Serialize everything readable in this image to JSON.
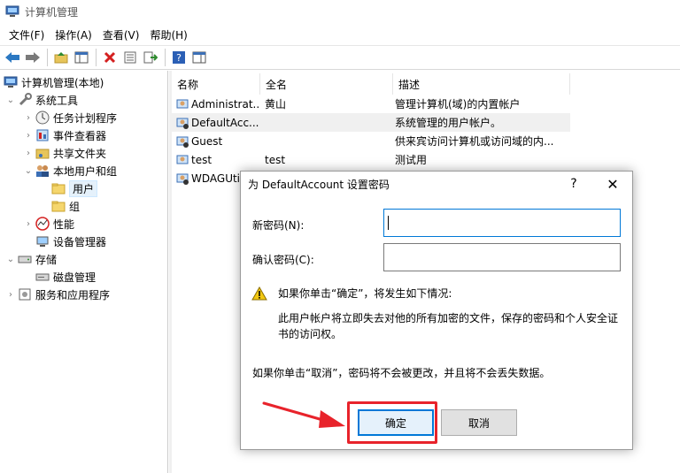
{
  "window": {
    "title": "计算机管理"
  },
  "menu": [
    "文件(F)",
    "操作(A)",
    "查看(V)",
    "帮助(H)"
  ],
  "toolbar": {
    "icons": [
      "back-icon",
      "forward-icon",
      "up-folder-icon",
      "show-tree-icon",
      "delete-icon",
      "properties-icon",
      "export-icon",
      "help-icon",
      "show-pane-icon"
    ]
  },
  "tree": {
    "root": "计算机管理(本地)",
    "system_tools": "系统工具",
    "task_scheduler": "任务计划程序",
    "event_viewer": "事件查看器",
    "shared_folders": "共享文件夹",
    "local_users_groups": "本地用户和组",
    "users": "用户",
    "groups": "组",
    "performance": "性能",
    "device_manager": "设备管理器",
    "storage": "存储",
    "disk_management": "磁盘管理",
    "services_apps": "服务和应用程序"
  },
  "list": {
    "columns": [
      "名称",
      "全名",
      "描述"
    ],
    "rows": [
      {
        "name": "Administrat...",
        "fullname": "黄山",
        "desc": "管理计算机(域)的内置帐户"
      },
      {
        "name": "DefaultAcc...",
        "fullname": "",
        "desc": "系统管理的用户帐户。"
      },
      {
        "name": "Guest",
        "fullname": "",
        "desc": "供来宾访问计算机或访问域的内..."
      },
      {
        "name": "test",
        "fullname": "test",
        "desc": "测试用"
      },
      {
        "name": "WDAGUti",
        "fullname": "",
        "desc": ""
      }
    ]
  },
  "dialog": {
    "title": "为 DefaultAccount 设置密码",
    "help_label": "?",
    "close_label": "✕",
    "new_password_label": "新密码(N):",
    "confirm_password_label": "确认密码(C):",
    "new_password_value": "",
    "confirm_password_value": "",
    "warning_heading": "如果你单击“确定”，将发生如下情况:",
    "warning_line1": "此用户帐户将立即失去对他的所有加密的文件，保存的密码和个人安全证",
    "warning_line2": "书的访问权。",
    "cancel_note": "如果你单击“取消”，密码将不会被更改，并且将不会丢失数据。",
    "ok_label": "确定",
    "cancel_label": "取消"
  },
  "colors": {
    "annotation": "#e8232b",
    "focus": "#0078d7"
  }
}
